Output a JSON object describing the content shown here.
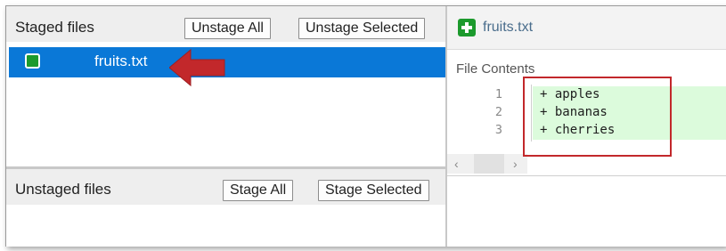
{
  "staged": {
    "title": "Staged files",
    "unstage_all": "Unstage All",
    "unstage_selected": "Unstage Selected",
    "items": [
      {
        "name": "fruits.txt",
        "status_icon": "plus-box-icon"
      }
    ]
  },
  "unstaged": {
    "title": "Unstaged files",
    "stage_all": "Stage All",
    "stage_selected": "Stage Selected"
  },
  "diff": {
    "file_name": "fruits.txt",
    "header_icon": "plus-box-icon",
    "section_label": "File Contents",
    "lines": [
      {
        "number": "1",
        "text": "+ apples"
      },
      {
        "number": "2",
        "text": "+ bananas"
      },
      {
        "number": "3",
        "text": "+ cherries"
      }
    ]
  },
  "annotations": {
    "arrow_color": "#c2282b",
    "highlight_color": "#c2282b"
  },
  "colors": {
    "selection": "#0a78d7",
    "added_line": "#dcfbdc",
    "status_added": "#1c9a2d"
  }
}
